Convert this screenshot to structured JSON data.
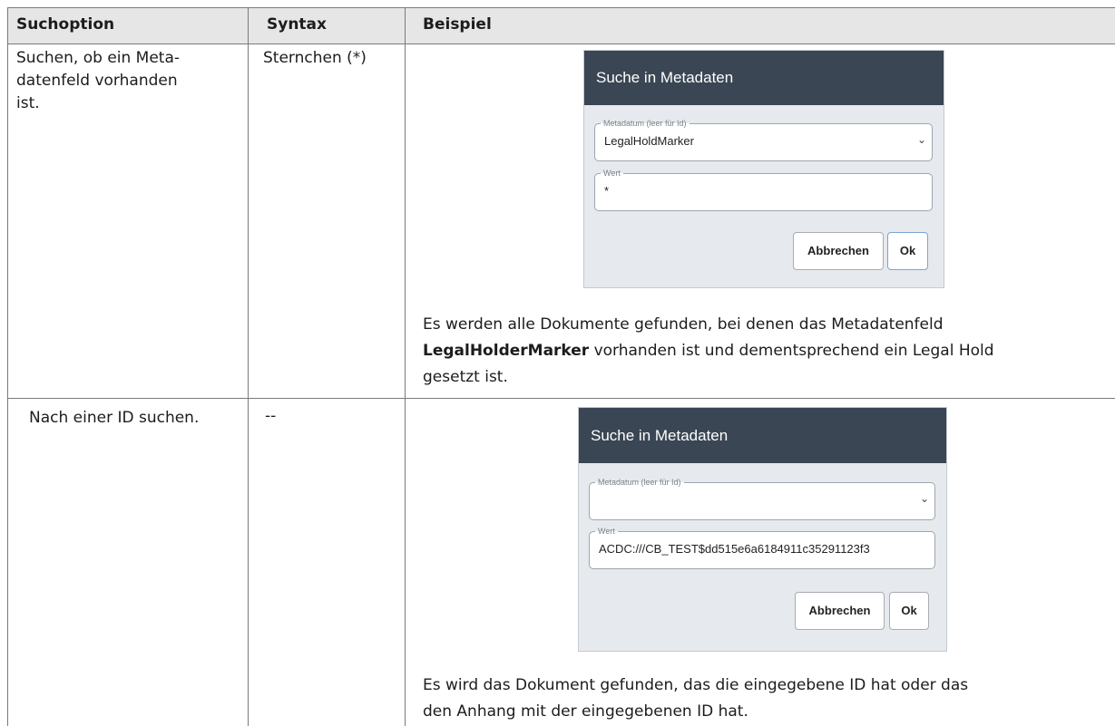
{
  "table": {
    "headers": [
      "Suchoption",
      "Syntax",
      "Beispiel"
    ],
    "rows": [
      {
        "option_lines": [
          "Suchen, ob ein Meta-",
          "datenfeld vorhanden",
          "ist."
        ],
        "syntax": "Sternchen (*)",
        "dialog": {
          "title": "Suche in Metadaten",
          "field1_legend": "Metadatum (leer für Id)",
          "field1_value": "LegalHoldMarker",
          "field2_legend": "Wert",
          "field2_value": "*",
          "cancel_label": "Abbrechen",
          "ok_label": "Ok"
        },
        "description": {
          "line1": "Es werden alle Dokumente gefunden, bei denen das Metadatenfeld",
          "line2_bold": "LegalHolderMarker",
          "line2_rest": " vorhanden ist und dementsprechend ein Legal Hold",
          "line3": "gesetzt ist."
        }
      },
      {
        "option_lines": [
          "Nach einer ID suchen."
        ],
        "syntax": "--",
        "dialog": {
          "title": "Suche in Metadaten",
          "field1_legend": "Metadatum (leer für Id)",
          "field1_value": "",
          "field2_legend": "Wert",
          "field2_value": "ACDC:///CB_TEST$dd515e6a6184911c35291123f3",
          "cancel_label": "Abbrechen",
          "ok_label": "Ok"
        },
        "description": {
          "line1": "Es wird das Dokument gefunden, das die eingegebene ID hat oder das",
          "line2": "den Anhang mit der eingegebenen ID hat."
        }
      }
    ]
  },
  "colors": {
    "header_bg": "#e6e6e6",
    "dialog_title_bg": "#3a4653",
    "dialog_body_bg": "#e6e9ed"
  }
}
